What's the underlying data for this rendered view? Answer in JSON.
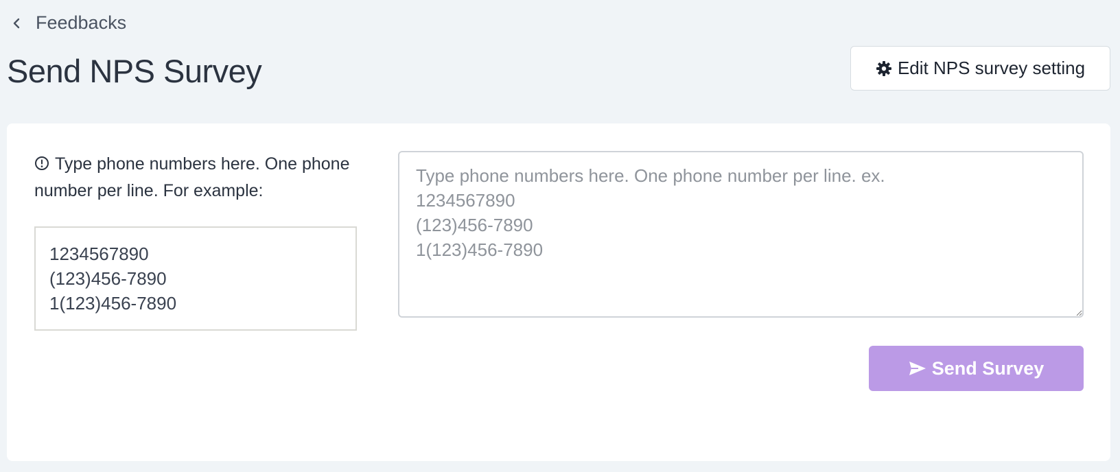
{
  "breadcrumb": {
    "icon": "chevron-left-icon",
    "label": "Feedbacks"
  },
  "header": {
    "title": "Send NPS Survey",
    "settings_button": {
      "icon": "gear-icon",
      "label": "Edit NPS survey setting"
    }
  },
  "form": {
    "hint": {
      "icon": "info-circle-icon",
      "text": "Type phone numbers here. One phone number per line. For example:"
    },
    "examples": [
      "1234567890",
      "(123)456-7890",
      "1(123)456-7890"
    ],
    "phone_input": {
      "value": "",
      "placeholder": "Type phone numbers here. One phone number per line. ex.\n1234567890\n(123)456-7890\n1(123)456-7890"
    },
    "send_button": {
      "icon": "send-icon",
      "label": "Send Survey",
      "color": "#bb9ae6"
    }
  },
  "colors": {
    "page_background": "#f0f4f7",
    "card_background": "#ffffff",
    "title_text": "#2b3340"
  }
}
